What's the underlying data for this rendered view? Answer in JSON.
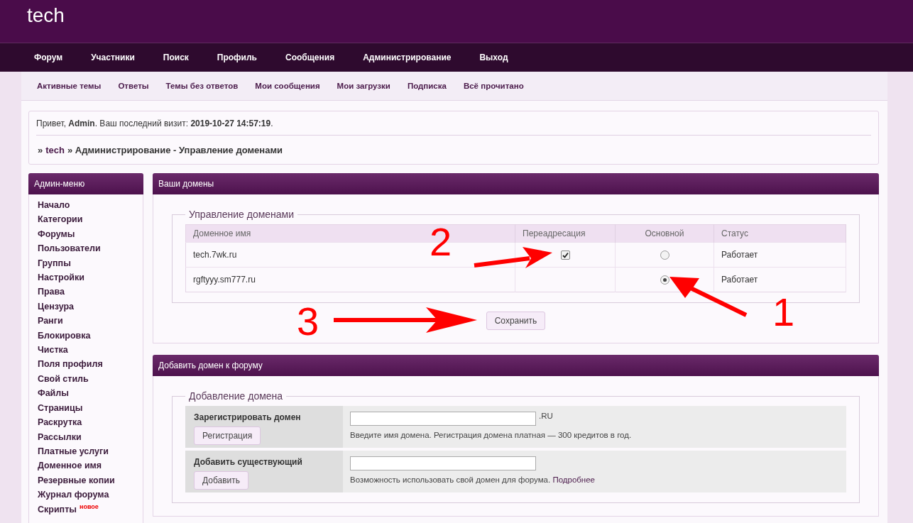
{
  "site": {
    "title": "tech"
  },
  "main_nav": [
    "Форум",
    "Участники",
    "Поиск",
    "Профиль",
    "Сообщения",
    "Администрирование",
    "Выход"
  ],
  "sub_nav": [
    "Активные темы",
    "Ответы",
    "Темы без ответов",
    "Мои сообщения",
    "Мои загрузки",
    "Подписка",
    "Всё прочитано"
  ],
  "greeting": {
    "text": "Привет, **Admin**.  Ваш последний визит: **2019-10-27 14:57:19**."
  },
  "breadcrumb": {
    "prefix": "»",
    "root": "tech",
    "path": "» Администрирование - Управление доменами"
  },
  "sidebar": {
    "title": "Админ-меню",
    "items": [
      {
        "label": "Начало"
      },
      {
        "label": "Категории"
      },
      {
        "label": "Форумы"
      },
      {
        "label": "Пользователи"
      },
      {
        "label": "Группы"
      },
      {
        "label": "Настройки"
      },
      {
        "label": "Права"
      },
      {
        "label": "Цензура"
      },
      {
        "label": "Ранги"
      },
      {
        "label": "Блокировка"
      },
      {
        "label": "Чистка"
      },
      {
        "label": "Поля профиля"
      },
      {
        "label": "Свой стиль"
      },
      {
        "label": "Файлы"
      },
      {
        "label": "Страницы"
      },
      {
        "label": "Раскрутка"
      },
      {
        "label": "Рассылки"
      },
      {
        "label": "Платные услуги"
      },
      {
        "label": "Доменное имя"
      },
      {
        "label": "Резервные копии"
      },
      {
        "label": "Журнал форума"
      },
      {
        "label": "Скрипты",
        "badge": "новое"
      }
    ]
  },
  "domains_panel": {
    "title": "Ваши домены",
    "fieldset": "Управление доменами",
    "columns": [
      "Доменное имя",
      "Переадресация",
      "Основной",
      "Статус"
    ],
    "rows": [
      {
        "domain": "tech.7wk.ru",
        "redirect_checked": true,
        "selected": false,
        "status": "Работает"
      },
      {
        "domain": "rgftyyy.sm777.ru",
        "selected": true,
        "status": "Работает"
      }
    ],
    "save_button": "Сохранить"
  },
  "add_panel": {
    "title": "Добавить домен к форуму",
    "fieldset": "Добавление домена",
    "rows": [
      {
        "label": "Зарегистрировать домен",
        "button": "Регистрация",
        "suffix": ".RU",
        "hint": "Введите имя домена. Регистрация домена платная — 300 кредитов в год."
      },
      {
        "label": "Добавить существующий",
        "button": "Добавить",
        "hint": "Возможность использовать свой домен для форума.",
        "link": "Подробнее"
      }
    ]
  },
  "annotations": [
    {
      "label": "2",
      "kind": "redirect"
    },
    {
      "label": "1",
      "kind": "primary"
    },
    {
      "label": "3",
      "kind": "save"
    }
  ]
}
